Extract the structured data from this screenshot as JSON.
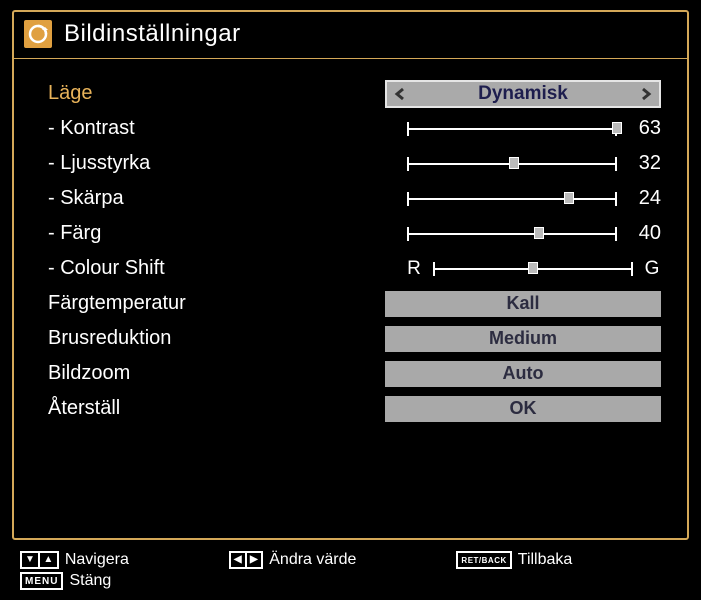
{
  "title": "Bildinställningar",
  "rows": {
    "mode": {
      "label": "Läge",
      "value": "Dynamisk"
    },
    "contrast": {
      "label": "- Kontrast",
      "value": 63,
      "max": 63
    },
    "brightness": {
      "label": "- Ljusstyrka",
      "value": 32,
      "max": 63
    },
    "sharpness": {
      "label": "- Skärpa",
      "value": 24,
      "max": 31
    },
    "colour": {
      "label": "- Färg",
      "value": 40,
      "max": 63
    },
    "colourshift": {
      "label": "- Colour Shift",
      "prefix": "R",
      "suffix": "G",
      "value": 0,
      "min": -10,
      "max": 10
    },
    "colortemp": {
      "label": "Färgtemperatur",
      "value": "Kall"
    },
    "noise": {
      "label": "Brusreduktion",
      "value": "Medium"
    },
    "zoom": {
      "label": "Bildzoom",
      "value": "Auto"
    },
    "reset": {
      "label": "Återställ",
      "value": "OK"
    }
  },
  "footer": {
    "navigate": "Navigera",
    "change": "Ändra värde",
    "back": "Tillbaka",
    "close": "Stäng",
    "back_key": "RET/BACK",
    "menu_key": "MENU"
  }
}
